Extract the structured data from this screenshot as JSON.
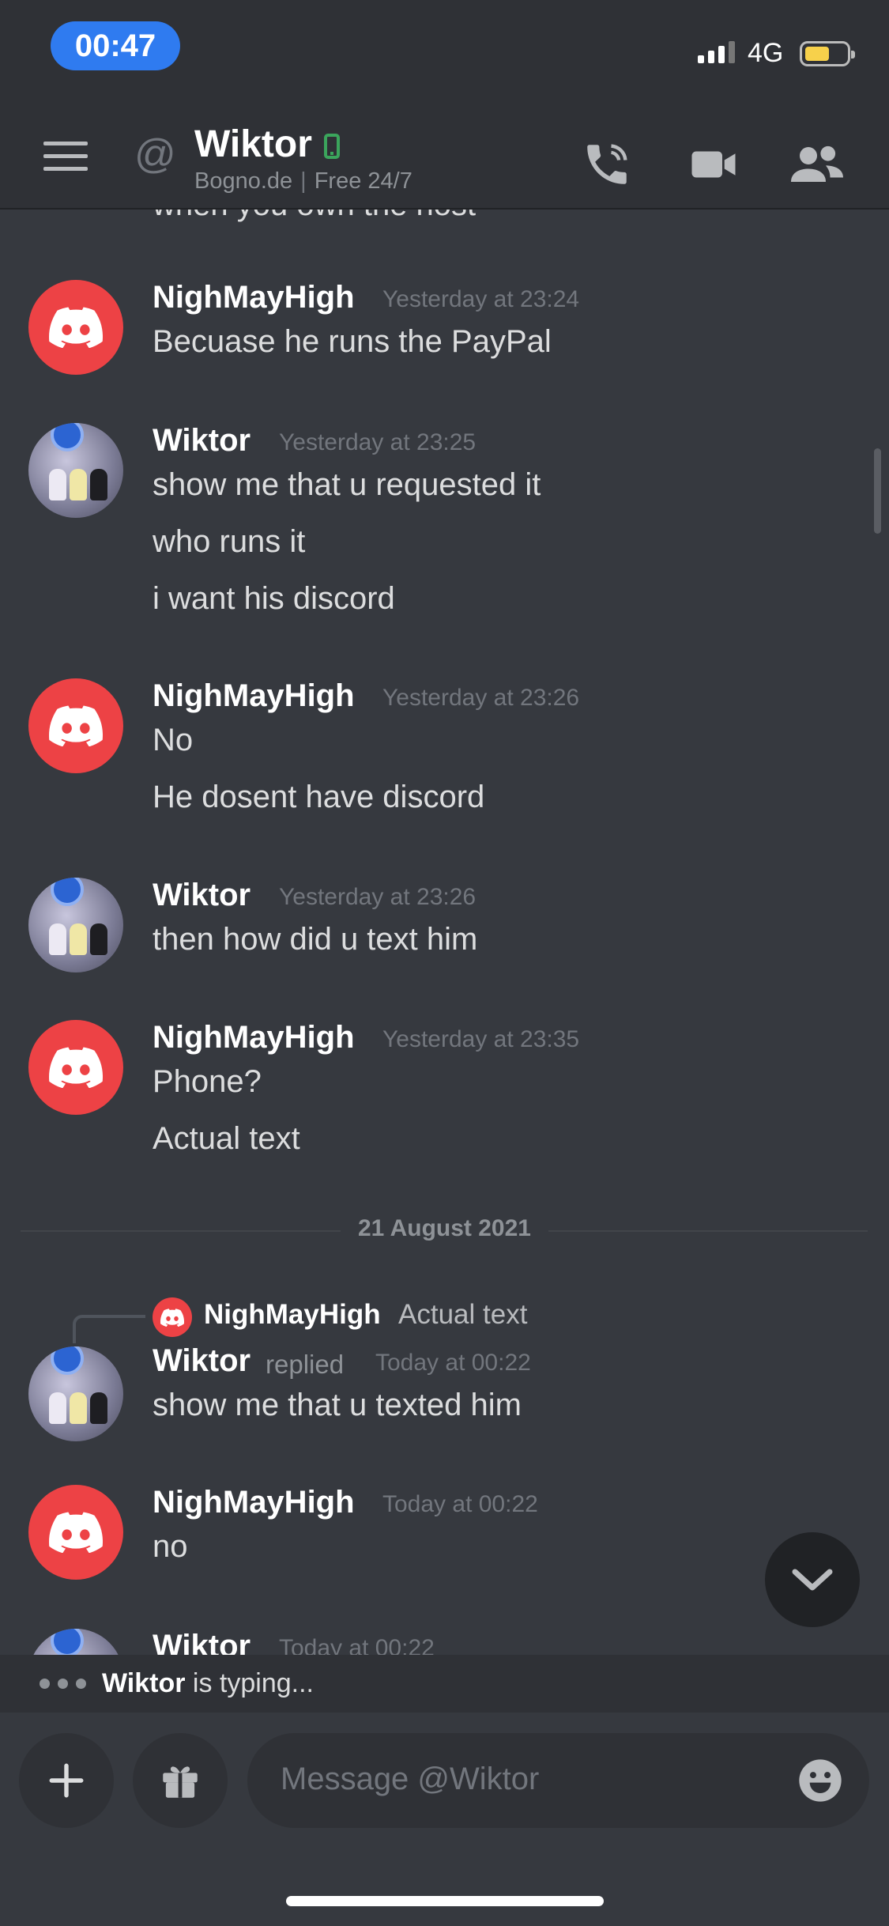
{
  "status_bar": {
    "time": "00:47",
    "network": "4G"
  },
  "header": {
    "channel_prefix": "@",
    "title": "Wiktor",
    "subtitle_left": "Bogno.de",
    "subtitle_right": "Free 24/7"
  },
  "partial_top_text": "when you own the host",
  "messages": [
    {
      "author": "NighMayHigh",
      "timestamp": "Yesterday at 23:24",
      "lines": [
        "Becuase he runs the PayPal"
      ]
    },
    {
      "author": "Wiktor",
      "timestamp": "Yesterday at 23:25",
      "lines": [
        "show me that u requested it",
        "who runs it",
        "i want his discord"
      ]
    },
    {
      "author": "NighMayHigh",
      "timestamp": "Yesterday at 23:26",
      "lines": [
        "No",
        "He dosent have discord"
      ]
    },
    {
      "author": "Wiktor",
      "timestamp": "Yesterday at 23:26",
      "lines": [
        "then how did u text him"
      ]
    },
    {
      "author": "NighMayHigh",
      "timestamp": "Yesterday at 23:35",
      "lines": [
        "Phone?",
        "Actual text"
      ]
    }
  ],
  "date_divider": "21 August 2021",
  "reply": {
    "ref_author": "NighMayHigh",
    "ref_text": "Actual text",
    "author": "Wiktor",
    "replied_label": "replied",
    "timestamp": "Today at 00:22",
    "line": "show me that u texted him"
  },
  "latest": {
    "author": "NighMayHigh",
    "timestamp": "Today at 00:22",
    "line": "no"
  },
  "partial_bottom": {
    "author": "Wiktor",
    "timestamp": "Today at 00:22"
  },
  "typing": {
    "name": "Wiktor",
    "suffix": " is typing..."
  },
  "composer": {
    "placeholder": "Message @Wiktor"
  },
  "colors": {
    "accent_red": "#ed4245",
    "online_green": "#3ba55c",
    "background": "#36393f"
  }
}
